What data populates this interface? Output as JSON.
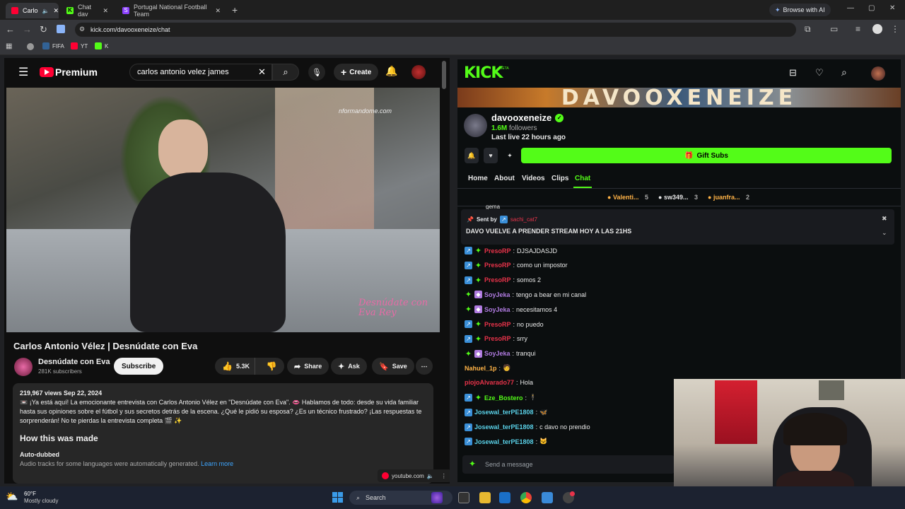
{
  "browser": {
    "tabs": [
      {
        "label": "Carlo",
        "color": "#ff0033"
      },
      {
        "label": "Chat dav",
        "color": "#53fc18"
      },
      {
        "label": "Portugal National Football Team",
        "color": "#8a3ffc"
      }
    ],
    "browse_ai": "Browse with AI",
    "url": "kick.com/davooxeneize/chat",
    "bookmarks": [
      "FIFA",
      "YT",
      "K"
    ]
  },
  "youtube": {
    "brand": "Premium",
    "search_value": "carlos antonio velez james",
    "create_label": "Create",
    "video_watermark": "nformandome.com",
    "video_logo": "Desnúdate con Eva Rey",
    "title": "Carlos Antonio Vélez | Desnúdate con Eva",
    "channel": "Desnúdate con Eva",
    "subscribers": "281K subscribers",
    "subscribe_label": "Subscribe",
    "likes": "5.3K",
    "share_label": "Share",
    "ask_label": "Ask",
    "save_label": "Save",
    "views_date": "219,967 views  Sep 22, 2024",
    "description": "📼 ¡Ya está aquí! La emocionante entrevista con Carlos Antonio Vélez en \"Desnúdate con Eva\". 👄 Hablamos de todo: desde su vida familiar hasta sus opiniones sobre el fútbol y sus secretos detrás de la escena. ¿Qué le pidió su esposa? ¿Es un técnico frustrado? ¡Las respuestas te sorprenderán! No te pierdas la entrevista completa 🎬 ✨",
    "how_made": "How this was made",
    "auto_dubbed": "Auto-dubbed",
    "auto_dubbed_note": "Audio tracks for some languages were automatically generated.",
    "learn_more": "Learn more",
    "pip_source": "youtube.com"
  },
  "kick": {
    "logo": "KICK",
    "beta": "BETA",
    "banner_text": "DAVOOXENEIZE",
    "channel": "davooxeneize",
    "followers_count": "1.6M",
    "followers_label": "followers",
    "last_live": "Last live 22 hours ago",
    "gift_label": "Gift Subs",
    "nav": [
      "Home",
      "About",
      "Videos",
      "Clips",
      "Chat"
    ],
    "leaderboard": [
      {
        "name": "Valenti...",
        "count": "5",
        "color": "#ffb347"
      },
      {
        "name": "sw349...",
        "count": "3",
        "color": "#e8e8e8"
      },
      {
        "name": "juanfra...",
        "count": "2",
        "color": "#ffb347"
      }
    ],
    "partial_top": "gema",
    "pinned_by_label": "Sent by",
    "pinned_by_user": "sachi_cat7",
    "pinned_text": "DAVO VUELVE A PRENDER STREAM HOY A LAS 21HS",
    "messages": [
      {
        "badges": [
          "blue",
          "green"
        ],
        "user": "PresoRP",
        "color": "#e8334a",
        "text": "DJSAJDASJD"
      },
      {
        "badges": [
          "blue",
          "green"
        ],
        "user": "PresoRP",
        "color": "#e8334a",
        "text": "como un impostor"
      },
      {
        "badges": [
          "blue",
          "green"
        ],
        "user": "PresoRP",
        "color": "#e8334a",
        "text": "somos 2"
      },
      {
        "badges": [
          "green",
          "purple"
        ],
        "user": "SoyJeka",
        "color": "#b07be0",
        "text": "tengo a bear en mi canal"
      },
      {
        "badges": [
          "green",
          "purple"
        ],
        "user": "SoyJeka",
        "color": "#b07be0",
        "text": "necesitamos 4"
      },
      {
        "badges": [
          "blue",
          "green"
        ],
        "user": "PresoRP",
        "color": "#e8334a",
        "text": "no puedo"
      },
      {
        "badges": [
          "blue",
          "green"
        ],
        "user": "PresoRP",
        "color": "#e8334a",
        "text": "srry"
      },
      {
        "badges": [
          "green",
          "purple"
        ],
        "user": "SoyJeka",
        "color": "#b07be0",
        "text": "tranqui"
      },
      {
        "badges": [],
        "user": "Nahuel_1p",
        "color": "#ffb347",
        "text": "🧑"
      },
      {
        "badges": [],
        "user": "piojoAlvarado77",
        "color": "#e8334a",
        "text": "Hola"
      },
      {
        "badges": [
          "blue",
          "green"
        ],
        "user": "Eze_Bostero",
        "color": "#53fc18",
        "text": "🕴"
      },
      {
        "badges": [
          "blue"
        ],
        "user": "Josewal_terPE1808",
        "color": "#5ad1e8",
        "text": "🦋"
      },
      {
        "badges": [
          "blue"
        ],
        "user": "Josewal_terPE1808",
        "color": "#5ad1e8",
        "text": "c davo no prendio"
      },
      {
        "badges": [
          "blue"
        ],
        "user": "Josewal_terPE1808",
        "color": "#5ad1e8",
        "text": "🐱"
      }
    ],
    "send_placeholder": "Send a message"
  },
  "taskbar": {
    "temp": "60°F",
    "weather": "Mostly cloudy",
    "search": "Search"
  }
}
